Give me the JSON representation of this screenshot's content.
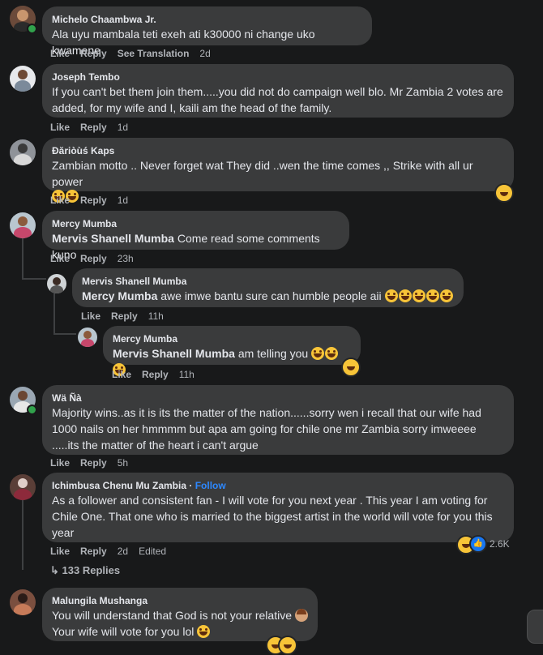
{
  "actions": {
    "like": "Like",
    "reply": "Reply",
    "see_translation": "See Translation",
    "edited": "Edited"
  },
  "comments": [
    {
      "author": "Michelo Chaambwa Jr.",
      "text": "Ala uyu mambala teti exeh ati k30000 ni change uko kwamene",
      "time": "2d"
    },
    {
      "author": "Joseph Tembo",
      "text": "If you can't bet them join them.....you did not do campaign well blo. Mr Zambia 2 votes are added, for my wife and I, kaili am the head of the family.",
      "time": "1d"
    },
    {
      "author": "Ðăriòùś Kaps",
      "text": "Zambian motto .. Never forget wat They did ..wen the time comes ,, Strike with all ur power",
      "time": "1d"
    },
    {
      "author": "Mercy Mumba",
      "mention": "Mervis Shanell Mumba",
      "text": " Come read some comments kuno",
      "time": "23h"
    },
    {
      "author": "Mervis Shanell Mumba",
      "mention": "Mercy Mumba",
      "text": " awe imwe bantu sure can humble people aii",
      "time": "11h"
    },
    {
      "author": "Mercy Mumba",
      "mention": "Mervis Shanell Mumba",
      "text": " am telling you",
      "time": "11h"
    },
    {
      "author": "Wä Ñà",
      "text": "Majority wins..as it is its the matter of the nation......sorry wen i recall that our wife had 1000 nails on her hmmmm but apa am going for chile one mr Zambia sorry imweeee .....its the matter of the heart i can't argue",
      "time": "5h"
    },
    {
      "author": "Ichimbusa Chenu Mu Zambia",
      "follow": "Follow",
      "text": "As a follower and consistent fan - I will vote for you next year . This year I am voting for Chile One. That one who is married to the biggest artist in the world will vote for you this year",
      "time": "2d",
      "reaction_count": "2.6K"
    },
    {
      "author": "Malungila Mushanga",
      "line1": "You will understand that God is not your relative",
      "line2": "Your wife will vote for you lol"
    }
  ],
  "replies_link": "133 Replies",
  "icons": {
    "reply_arrow": "reply-arrow-icon",
    "emoji": "laughing-emoji-icon",
    "like": "like-reaction-icon"
  }
}
